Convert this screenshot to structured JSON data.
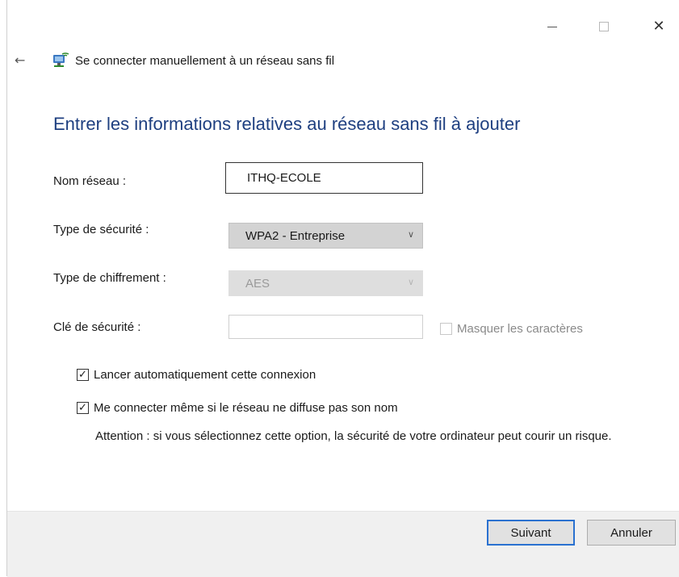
{
  "window": {
    "title": "Se connecter manuellement à un réseau sans fil",
    "controls": {
      "minimize": "—",
      "maximize": "□",
      "close": "✕"
    }
  },
  "icons": {
    "back": "back-arrow-icon",
    "app": "wireless-network-icon"
  },
  "heading": "Entrer les informations relatives au réseau sans fil à ajouter",
  "form": {
    "network_name": {
      "label": "Nom réseau :",
      "value": "ITHQ-ECOLE"
    },
    "security_type": {
      "label": "Type de sécurité :",
      "value": "WPA2 - Entreprise"
    },
    "encryption_type": {
      "label": "Type de chiffrement :",
      "value": "AES",
      "disabled": true
    },
    "security_key": {
      "label": "Clé de sécurité :",
      "value": "",
      "disabled": true
    },
    "mask_characters": {
      "label": "Masquer les caractères",
      "checked": false,
      "disabled": true
    }
  },
  "options": {
    "auto_connect": {
      "label": "Lancer automatiquement cette connexion",
      "checked": true
    },
    "connect_hidden": {
      "label": "Me connecter même si le réseau ne diffuse pas son nom",
      "checked": true
    },
    "warning": "Attention : si vous sélectionnez cette option, la sécurité de votre ordinateur peut courir un risque."
  },
  "buttons": {
    "next": "Suivant",
    "cancel": "Annuler"
  },
  "colors": {
    "heading": "#1e3f80",
    "focus_border": "#2a71d0",
    "footer_bg": "#f0f0f0"
  }
}
